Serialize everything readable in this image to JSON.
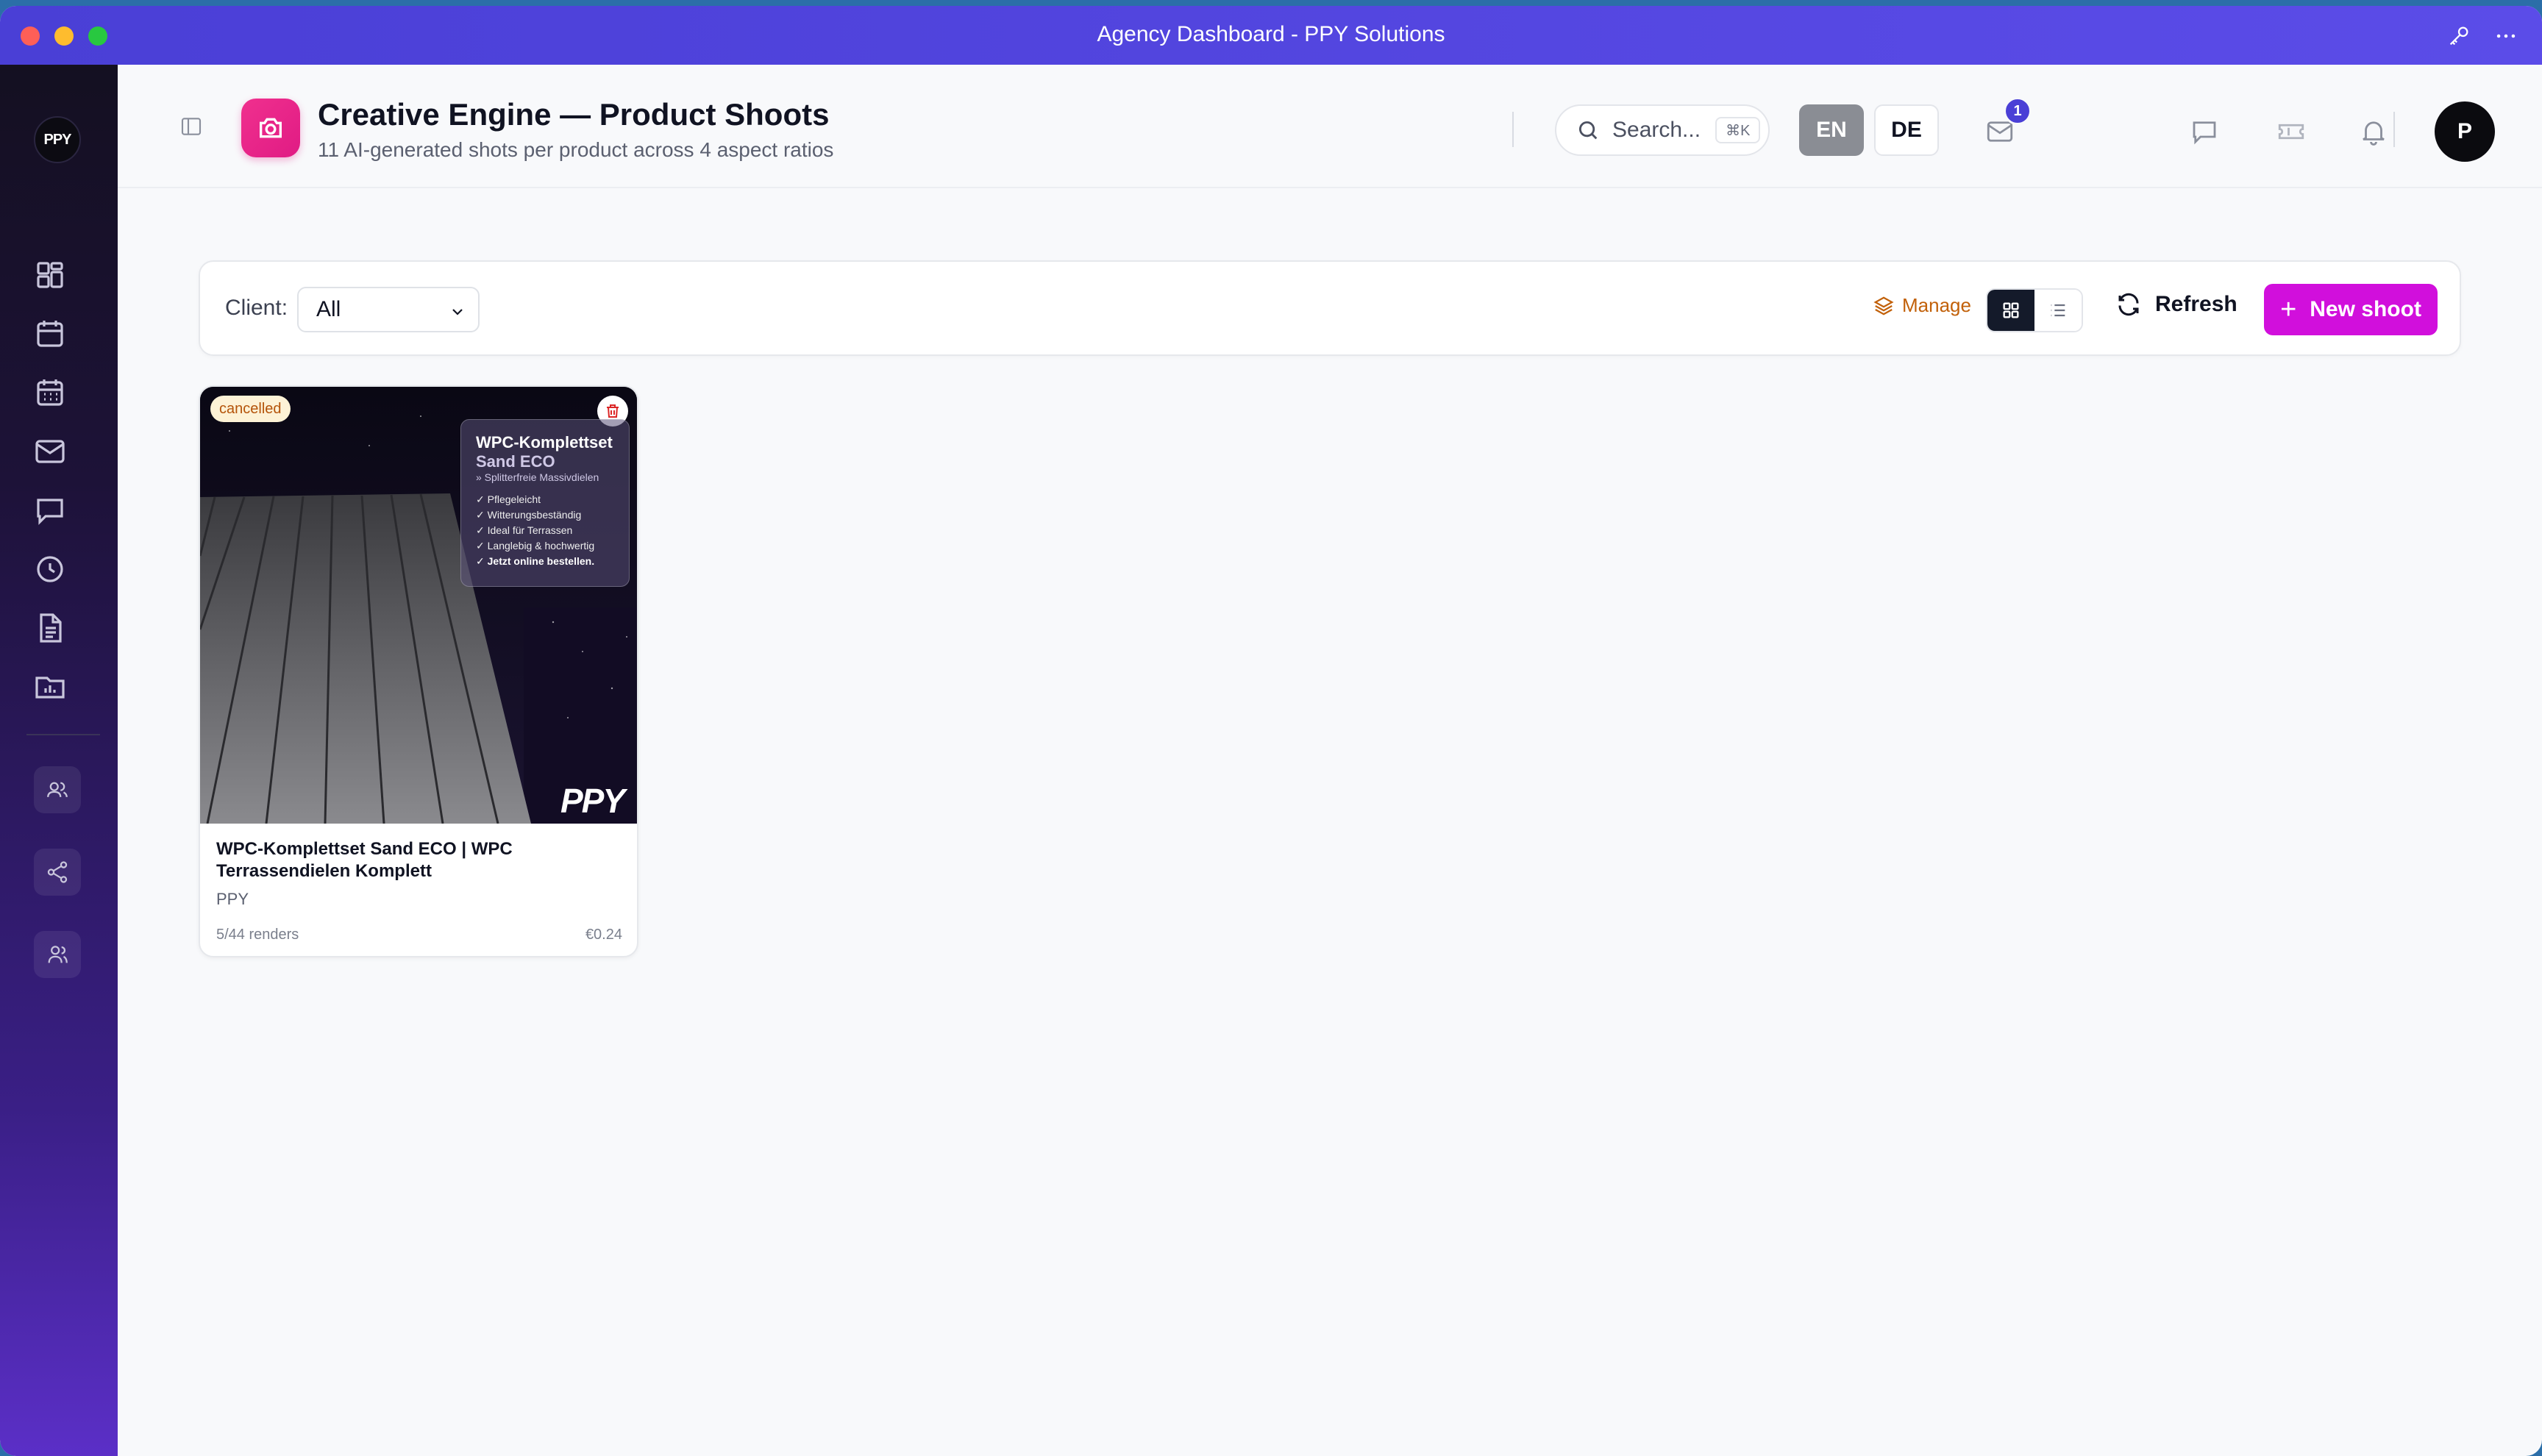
{
  "window": {
    "title": "Agency Dashboard - PPY Solutions"
  },
  "sidebar": {
    "logo": "PPY",
    "items": [
      {
        "icon": "dashboard-grid-icon"
      },
      {
        "icon": "calendar-icon"
      },
      {
        "icon": "calendar-grid-icon"
      },
      {
        "icon": "mail-icon"
      },
      {
        "icon": "chat-icon"
      },
      {
        "icon": "clock-icon"
      },
      {
        "icon": "document-icon"
      },
      {
        "icon": "folder-chart-icon"
      }
    ],
    "bottom_items": [
      {
        "icon": "users-icon"
      },
      {
        "icon": "share-icon"
      },
      {
        "icon": "user-group-icon"
      }
    ]
  },
  "header": {
    "title": "Creative Engine — Product Shoots",
    "subtitle": "11 AI-generated shots per product across 4 aspect ratios",
    "search_placeholder": "Search...",
    "search_shortcut": "⌘K",
    "lang_en": "EN",
    "lang_de": "DE",
    "mail_badge": "1",
    "avatar_initial": "P"
  },
  "toolbar": {
    "client_label": "Client:",
    "client_value": "All",
    "manage_label": "Manage",
    "refresh_label": "Refresh",
    "new_shoot_label": "New shoot"
  },
  "cards": [
    {
      "status": "cancelled",
      "title": "WPC-Komplettset Sand ECO | WPC Terrassendielen Komplett",
      "client": "PPY",
      "renders": "5/44 renders",
      "cost": "€0.24",
      "overlay": {
        "title": "WPC-Komplettset",
        "subtitle": "Sand ECO",
        "tag": "» Splitterfreie Massivdielen",
        "items": [
          "✓ Pflegeleicht",
          "✓ Witterungsbeständig",
          "✓ Ideal für Terrassen",
          "✓ Langlebig & hochwertig",
          "✓ Jetzt online bestellen."
        ]
      },
      "watermark": "PPY"
    }
  ],
  "colors": {
    "accent": "#d10fdc",
    "titlebar": "#4a3fd6",
    "camera_badge": "#e01b84",
    "status_cancelled_bg": "#fdf2d6",
    "manage": "#c2610a"
  }
}
